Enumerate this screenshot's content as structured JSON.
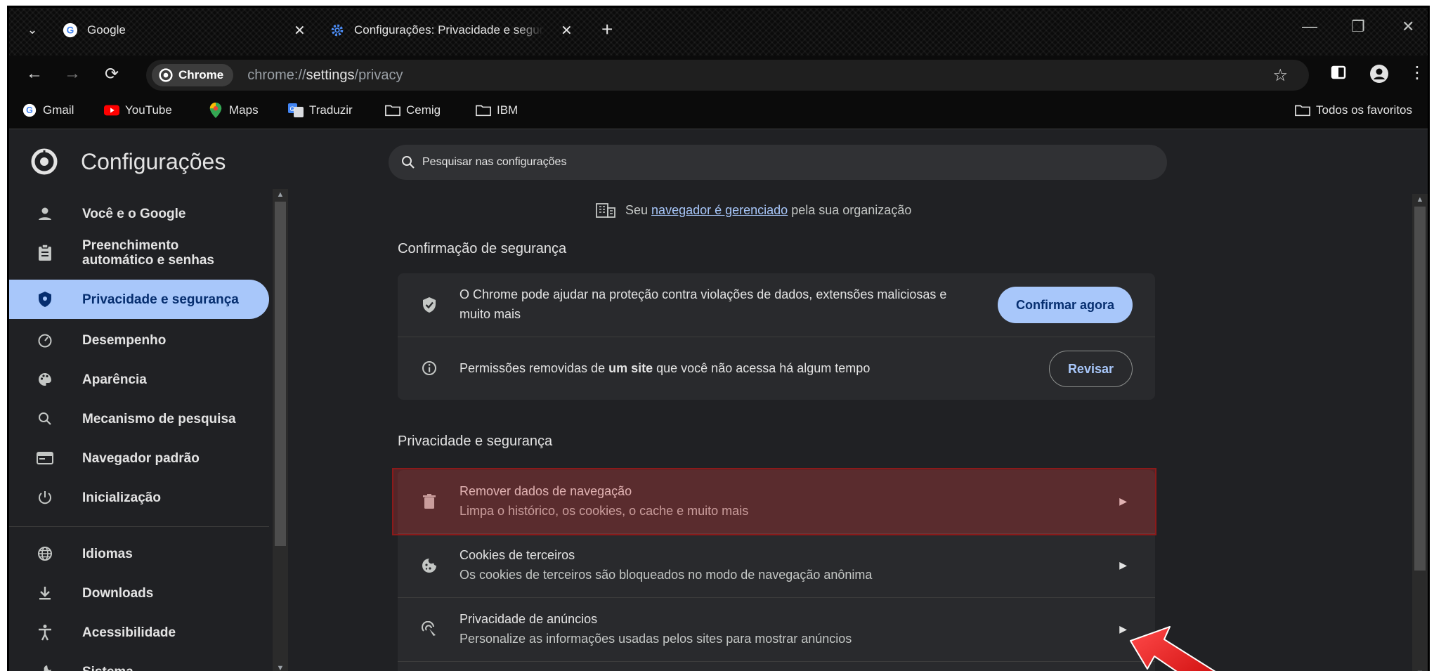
{
  "tabs": [
    {
      "label": "Google",
      "icon": "google-icon"
    },
    {
      "label": "Configurações: Privacidade e segurança",
      "icon": "settings-gear-icon"
    }
  ],
  "toolbar": {
    "chip_label": "Chrome",
    "url_prefix": "chrome://",
    "url_bold": "settings",
    "url_suffix": "/privacy"
  },
  "bookmarks": {
    "items": [
      {
        "label": "Gmail",
        "icon": "google-icon"
      },
      {
        "label": "YouTube",
        "icon": "youtube-icon"
      },
      {
        "label": "Maps",
        "icon": "maps-pin-icon"
      },
      {
        "label": "Traduzir",
        "icon": "translate-icon"
      },
      {
        "label": "Cemig",
        "icon": "folder-icon"
      },
      {
        "label": "IBM",
        "icon": "folder-icon"
      }
    ],
    "all_label": "Todos os favoritos"
  },
  "settings": {
    "title": "Configurações",
    "search_placeholder": "Pesquisar nas configurações",
    "managed_prefix": "Seu ",
    "managed_link": "navegador é gerenciado",
    "managed_suffix": " pela sua organização"
  },
  "sidebar": {
    "items": [
      {
        "label": "Você e o Google",
        "icon": "person-icon"
      },
      {
        "label": "Preenchimento automático e senhas",
        "icon": "clipboard-icon"
      },
      {
        "label": "Privacidade e segurança",
        "icon": "shield-icon",
        "active": true
      },
      {
        "label": "Desempenho",
        "icon": "speedometer-icon"
      },
      {
        "label": "Aparência",
        "icon": "palette-icon"
      },
      {
        "label": "Mecanismo de pesquisa",
        "icon": "search-icon"
      },
      {
        "label": "Navegador padrão",
        "icon": "browser-window-icon"
      },
      {
        "label": "Inicialização",
        "icon": "power-icon"
      },
      {
        "label": "Idiomas",
        "icon": "globe-icon"
      },
      {
        "label": "Downloads",
        "icon": "download-icon"
      },
      {
        "label": "Acessibilidade",
        "icon": "accessibility-icon"
      },
      {
        "label": "Sistema",
        "icon": "wrench-icon"
      }
    ]
  },
  "safety_check": {
    "title": "Confirmação de segurança",
    "rows": [
      {
        "text": "O Chrome pode ajudar na proteção contra violações de dados, extensões maliciosas e muito mais",
        "button": "Confirmar agora"
      },
      {
        "text_prefix": "Permissões removidas de ",
        "text_bold": "um site",
        "text_suffix": " que você não acessa há algum tempo",
        "button": "Revisar"
      }
    ]
  },
  "privacy": {
    "title": "Privacidade e segurança",
    "rows": [
      {
        "title": "Remover dados de navegação",
        "subtitle": "Limpa o histórico, os cookies, o cache e muito mais"
      },
      {
        "title": "Cookies de terceiros",
        "subtitle": "Os cookies de terceiros são bloqueados no modo de navegação anônima"
      },
      {
        "title": "Privacidade de anúncios",
        "subtitle": "Personalize as informações usadas pelos sites para mostrar anúncios"
      }
    ]
  },
  "colors": {
    "accent": "#a8c7fa",
    "highlight": "#8b1a1a",
    "annotation_arrow": "#e01010"
  }
}
